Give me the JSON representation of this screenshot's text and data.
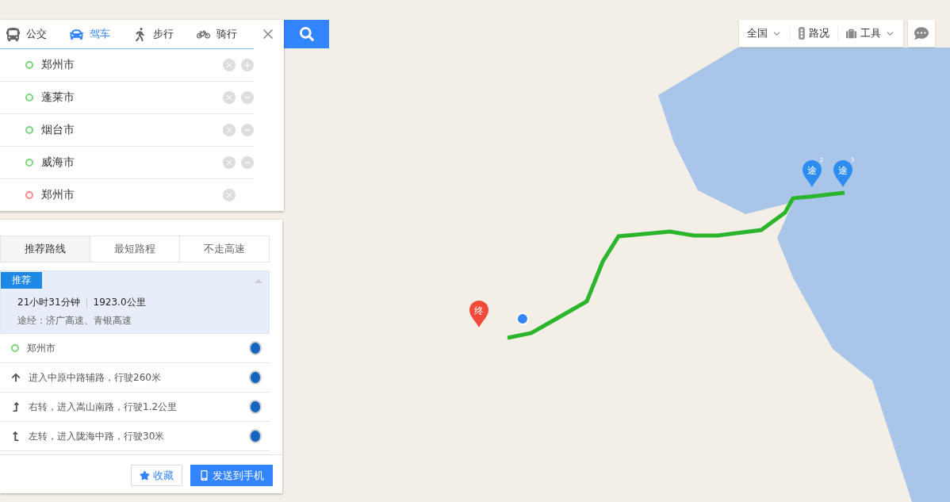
{
  "modes": [
    {
      "label": "公交",
      "kind": "bus",
      "selected": false
    },
    {
      "label": "驾车",
      "kind": "car",
      "selected": true
    },
    {
      "label": "步行",
      "kind": "walk",
      "selected": false
    },
    {
      "label": "骑行",
      "kind": "bike",
      "selected": false
    }
  ],
  "stops": [
    {
      "value": "郑州市",
      "kind": "start",
      "can_add": true,
      "can_remove": false
    },
    {
      "value": "蓬莱市",
      "kind": "via",
      "can_add": false,
      "can_remove": true
    },
    {
      "value": "烟台市",
      "kind": "via",
      "can_add": false,
      "can_remove": true
    },
    {
      "value": "威海市",
      "kind": "via",
      "can_add": false,
      "can_remove": true
    },
    {
      "value": "郑州市",
      "kind": "end",
      "can_add": false,
      "can_remove": false
    }
  ],
  "policies": [
    {
      "label": "推荐路线",
      "selected": true
    },
    {
      "label": "最短路程",
      "selected": false
    },
    {
      "label": "不走高速",
      "selected": false
    }
  ],
  "plan": {
    "badge": "推荐",
    "expanded": true,
    "duration": "21小时31分钟",
    "distance": "1923.0公里",
    "via": "途经：济广高速、青银高速"
  },
  "steps": [
    {
      "kind": "start",
      "text": "郑州市"
    },
    {
      "kind": "straight",
      "text": "进入中原中路辅路，行驶260米"
    },
    {
      "kind": "right",
      "text": "右转，进入嵩山南路，行驶1.2公里"
    },
    {
      "kind": "left",
      "text": "左转，进入陇海中路，行驶30米"
    }
  ],
  "actions": [
    {
      "kind": "favorite",
      "label": "收藏"
    },
    {
      "kind": "phone",
      "label": "发送到手机"
    }
  ],
  "toolbar": [
    {
      "kind": "region",
      "label": "全国",
      "dropdown": true
    },
    {
      "kind": "traffic",
      "label": "路况",
      "dropdown": false
    },
    {
      "kind": "tools",
      "label": "工具",
      "dropdown": true
    }
  ],
  "markers": [
    {
      "kind": "end",
      "label": "终"
    },
    {
      "kind": "via",
      "label": "途",
      "index": "2"
    },
    {
      "kind": "via",
      "label": "途",
      "index": "3"
    }
  ]
}
